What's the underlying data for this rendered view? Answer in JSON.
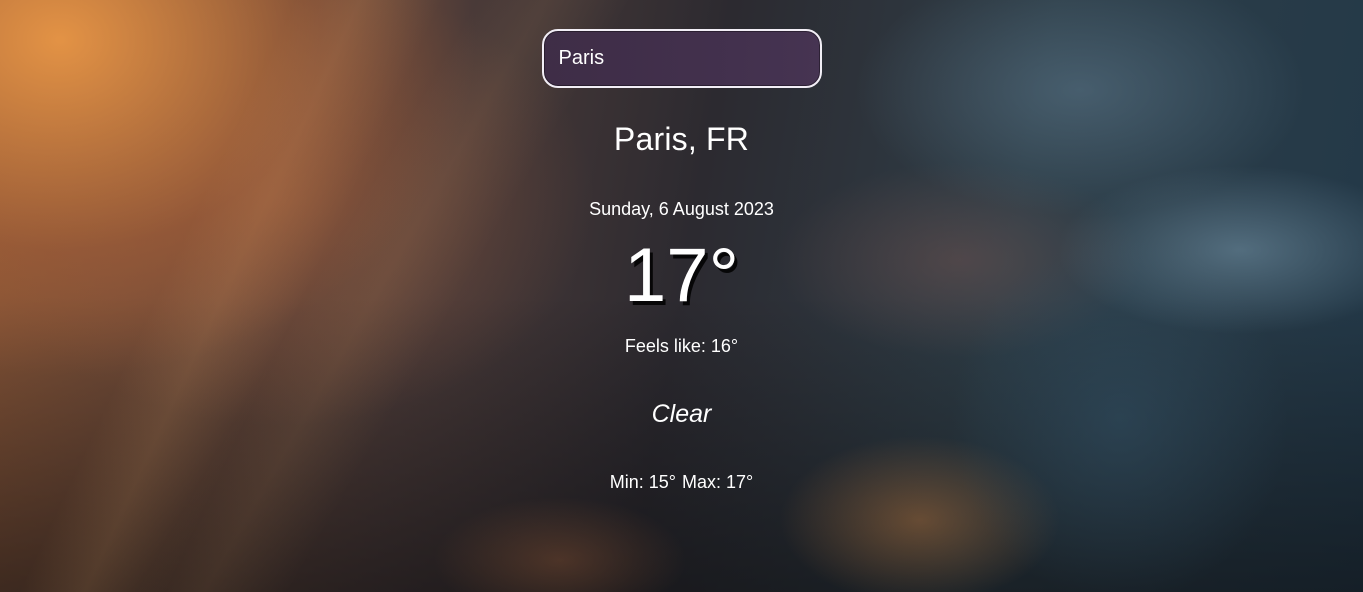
{
  "search": {
    "value": "Paris",
    "placeholder": ""
  },
  "weather": {
    "location": "Paris, FR",
    "date": "Sunday, 6 August 2023",
    "temperature": "17°",
    "feels_like": "Feels like: 16°",
    "description": "Clear",
    "min": "Min: 15°",
    "max": "Max: 17°"
  }
}
